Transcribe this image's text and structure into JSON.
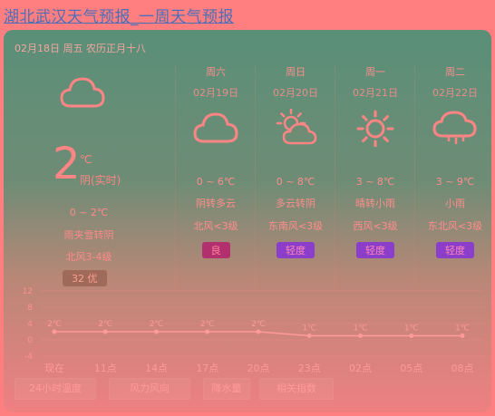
{
  "page": {
    "title": "湖北武汉天气预报_一周天气预报"
  },
  "today": {
    "date_line": "02月18日 周五 农历正月十八",
    "icon": "cloud-icon",
    "temp": "2",
    "unit": "℃",
    "condition": "阴(实时)",
    "range": "0 ~ 2℃",
    "desc": "雨夹雪转阴",
    "wind": "北风3-4级",
    "aqi": "32 优"
  },
  "forecast": [
    {
      "weekday": "周六",
      "date": "02月19日",
      "icon": "cloud-icon",
      "range": "0 ~ 6℃",
      "desc": "阴转多云",
      "wind": "北风<3级",
      "aqi": "良",
      "aqi_level": "good"
    },
    {
      "weekday": "周日",
      "date": "02月20日",
      "icon": "partly-cloudy-icon",
      "range": "0 ~ 8℃",
      "desc": "多云转阴",
      "wind": "东南风<3级",
      "aqi": "轻度",
      "aqi_level": "light"
    },
    {
      "weekday": "周一",
      "date": "02月21日",
      "icon": "sun-icon",
      "range": "3 ~ 8℃",
      "desc": "晴转小雨",
      "wind": "西风<3级",
      "aqi": "轻度",
      "aqi_level": "light"
    },
    {
      "weekday": "周二",
      "date": "02月22日",
      "icon": "rain-icon",
      "range": "3 ~ 9℃",
      "desc": "小雨",
      "wind": "东北风<3级",
      "aqi": "轻度",
      "aqi_level": "light"
    }
  ],
  "chart_data": {
    "type": "line",
    "categories": [
      "现在",
      "11点",
      "14点",
      "17点",
      "20点",
      "23点",
      "02点",
      "05点",
      "08点"
    ],
    "values": [
      2,
      2,
      2,
      2,
      2,
      1,
      1,
      1,
      1
    ],
    "labels": [
      "2℃",
      "2℃",
      "2℃",
      "2℃",
      "2℃",
      "1℃",
      "1℃",
      "1℃",
      "1℃"
    ],
    "yticks": [
      "12",
      "8",
      "4",
      "0",
      "-4"
    ],
    "ylim": [
      -4,
      12
    ]
  },
  "tabs": [
    "24小时温度",
    "风力风向",
    "降水量",
    "相关指数"
  ]
}
